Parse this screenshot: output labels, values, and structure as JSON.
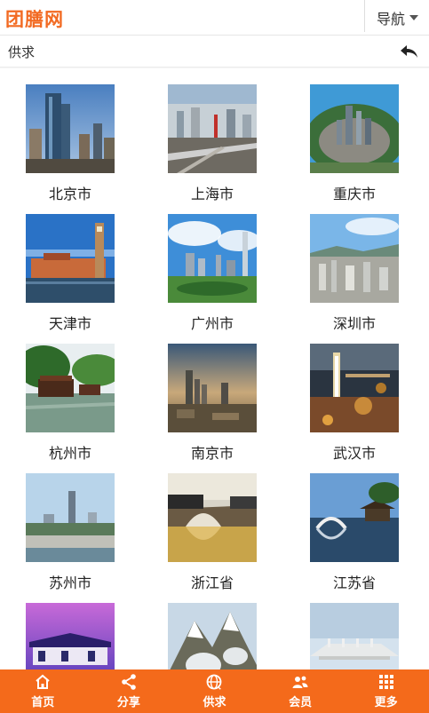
{
  "header": {
    "logo_text": "团膳网",
    "nav_label": "导航"
  },
  "subbar": {
    "title": "供求"
  },
  "cities": [
    {
      "name": "北京市",
      "icon": "beijing-skyline-photo"
    },
    {
      "name": "上海市",
      "icon": "shanghai-skyline-photo"
    },
    {
      "name": "重庆市",
      "icon": "chongqing-aerial-photo"
    },
    {
      "name": "天津市",
      "icon": "tianjin-riverside-photo"
    },
    {
      "name": "广州市",
      "icon": "guangzhou-skyline-photo"
    },
    {
      "name": "深圳市",
      "icon": "shenzhen-aerial-photo"
    },
    {
      "name": "杭州市",
      "icon": "hangzhou-boat-photo"
    },
    {
      "name": "南京市",
      "icon": "nanjing-sunset-photo"
    },
    {
      "name": "武汉市",
      "icon": "wuhan-night-photo"
    },
    {
      "name": "苏州市",
      "icon": "suzhou-skyline-photo"
    },
    {
      "name": "浙江省",
      "icon": "zhejiang-bridge-photo"
    },
    {
      "name": "江苏省",
      "icon": "jiangsu-garden-photo"
    },
    {
      "name": "",
      "icon": "purple-pavilion-photo"
    },
    {
      "name": "",
      "icon": "snowy-mountain-photo"
    },
    {
      "name": "",
      "icon": "stone-terrace-photo"
    }
  ],
  "footer": {
    "items": [
      {
        "label": "首页",
        "icon": "home-icon"
      },
      {
        "label": "分享",
        "icon": "share-icon"
      },
      {
        "label": "供求",
        "icon": "globe-icon"
      },
      {
        "label": "会员",
        "icon": "members-icon"
      },
      {
        "label": "更多",
        "icon": "grid-more-icon"
      }
    ]
  },
  "colors": {
    "brand": "#f26a22",
    "footer": "#f46a1b"
  }
}
